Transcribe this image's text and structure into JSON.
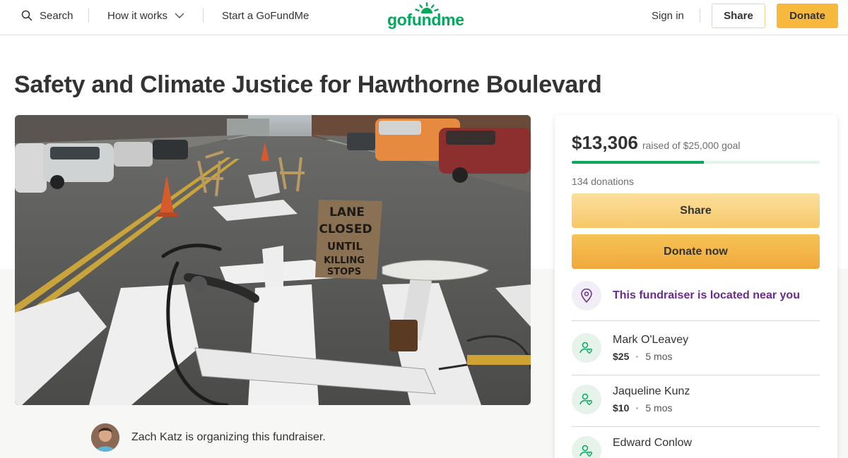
{
  "header": {
    "search_label": "Search",
    "how_it_works_label": "How it works",
    "start_label": "Start a GoFundMe",
    "logo_text": "gofundme",
    "sign_in_label": "Sign in",
    "share_label": "Share",
    "donate_label": "Donate"
  },
  "page_title": "Safety and Climate Justice for Hawthorne Boulevard",
  "hero_sign_text": [
    "LANE",
    "CLOSED",
    "UNTIL",
    "KILLING",
    "STOPS"
  ],
  "organizer": {
    "text": "Zach Katz is organizing this fundraiser."
  },
  "sidebar": {
    "raised_amount": "$13,306",
    "goal_text": "raised of $25,000 goal",
    "progress_fraction": 0.532,
    "donations_count": "134 donations",
    "share_label": "Share",
    "donate_label": "Donate now",
    "location_text": "This fundraiser is located near you",
    "donors": [
      {
        "name": "Mark O'Leavey",
        "amount": "$25",
        "time": "5 mos"
      },
      {
        "name": "Jaqueline Kunz",
        "amount": "$10",
        "time": "5 mos"
      },
      {
        "name": "Edward Conlow",
        "amount": "",
        "time": ""
      }
    ]
  },
  "colors": {
    "brand_green": "#02a95c",
    "donate_orange": "#f6b93e",
    "location_purple": "#6a2a8f"
  }
}
